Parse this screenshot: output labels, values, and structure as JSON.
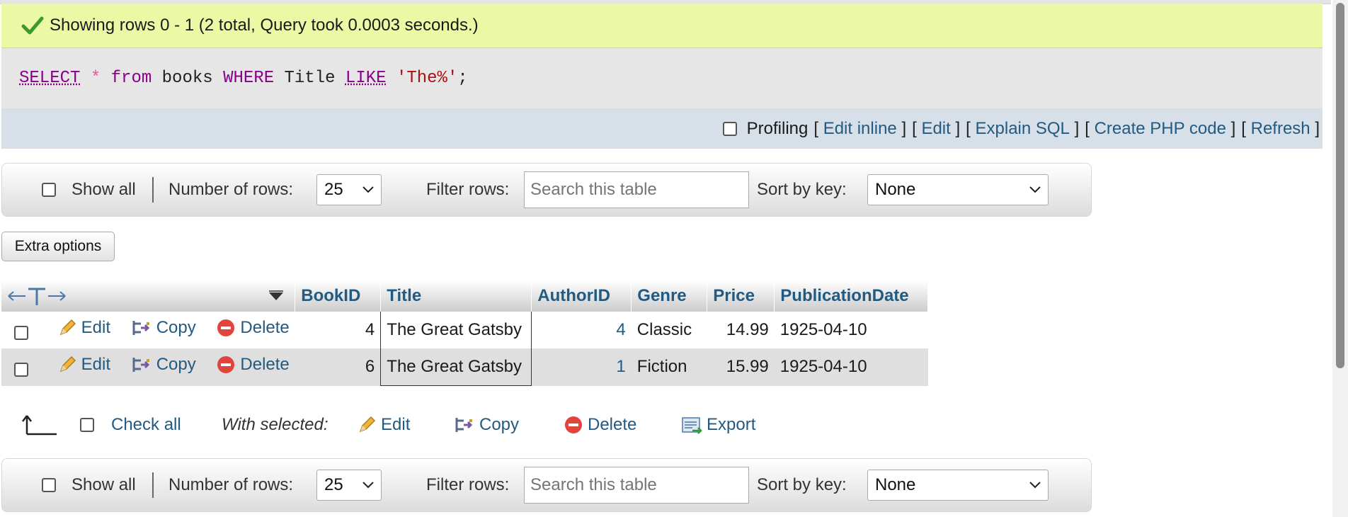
{
  "message": {
    "text": "Showing rows 0 - 1 (2 total, Query took 0.0003 seconds.)"
  },
  "sql": {
    "t1": "SELECT",
    "t2": " ",
    "t3": "*",
    "t4": " ",
    "t5": "from",
    "t6": " books ",
    "t7": "WHERE",
    "t8": " Title ",
    "t9": "LIKE",
    "t10": " ",
    "t11": "'The%'",
    "t12": ";"
  },
  "links": {
    "profiling": "Profiling",
    "edit_inline": "Edit inline",
    "edit": "Edit",
    "explain": "Explain SQL",
    "php": "Create PHP code",
    "refresh": "Refresh",
    "open": "[",
    "close": "]"
  },
  "nav": {
    "show_all": "Show all",
    "rows_label": "Number of rows:",
    "rows_value": "25",
    "filter_label": "Filter rows:",
    "filter_placeholder": "Search this table",
    "sort_label": "Sort by key:",
    "sort_value": "None"
  },
  "extra_options": "Extra options",
  "table": {
    "columns": [
      "BookID",
      "Title",
      "AuthorID",
      "Genre",
      "Price",
      "PublicationDate"
    ],
    "actions": {
      "edit": "Edit",
      "copy": "Copy",
      "delete": "Delete"
    },
    "rows": [
      {
        "BookID": "4",
        "Title": "The Great Gatsby",
        "AuthorID": "4",
        "Genre": "Classic",
        "Price": "14.99",
        "PublicationDate": "1925-04-10"
      },
      {
        "BookID": "6",
        "Title": "The Great Gatsby",
        "AuthorID": "1",
        "Genre": "Fiction",
        "Price": "15.99",
        "PublicationDate": "1925-04-10"
      }
    ]
  },
  "bulk": {
    "check_all": "Check all",
    "with_selected": "With selected:",
    "edit": "Edit",
    "copy": "Copy",
    "delete": "Delete",
    "export": "Export"
  },
  "colors": {
    "success_bg": "#ebf8a4",
    "link": "#235a81",
    "header_link": "#235a81",
    "row_alt": "#dfdfdf"
  }
}
